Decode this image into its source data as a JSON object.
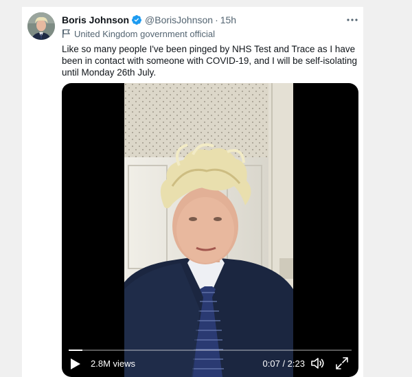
{
  "tweet": {
    "author_name": "Boris Johnson",
    "handle": "@BorisJohnson",
    "separator": "·",
    "timestamp": "15h",
    "label": "United Kingdom government official",
    "text": "Like so many people I've been pinged by NHS Test and Trace as I have been in contact with someone with COVID-19, and I will be self-isolating until Monday 26th July.",
    "more_icon": "more-horizontal-icon",
    "verified_icon": "verified-badge-icon",
    "label_icon": "flag-icon"
  },
  "video": {
    "views": "2.8M views",
    "time": "0:07 / 2:23",
    "progress": 0.049,
    "play_icon": "play-icon",
    "volume_icon": "volume-icon",
    "fullscreen_icon": "fullscreen-icon"
  },
  "colors": {
    "verified": "#1d9bf0",
    "text_primary": "#0f1419",
    "text_secondary": "#536471",
    "page_background": "#f0f0f0"
  }
}
